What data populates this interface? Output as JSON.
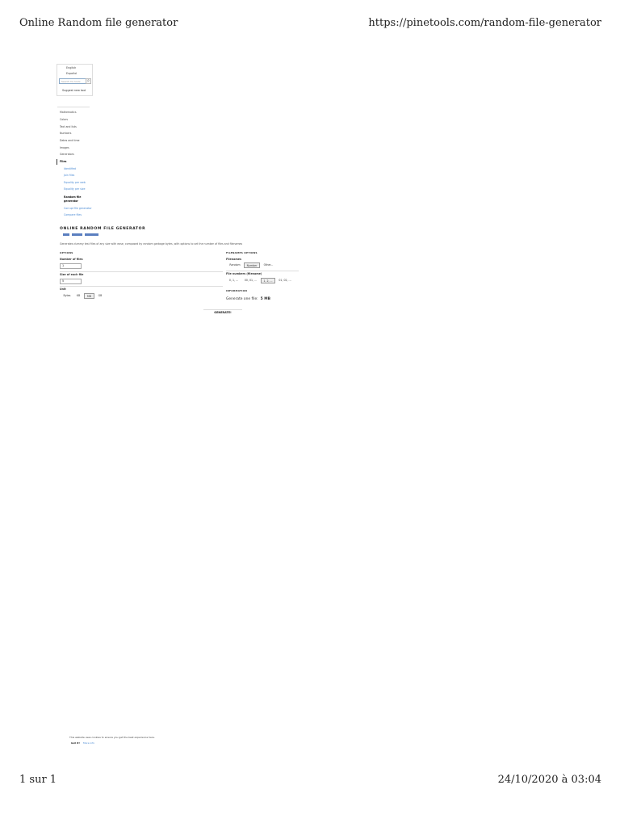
{
  "print_header": {
    "title": "Online Random file generator",
    "url": "https://pinetools.com/random-file-generator"
  },
  "print_footer": {
    "page": "1 sur 1",
    "datetime": "24/10/2020 à 03:04"
  },
  "sidebar": {
    "languages": [
      "English",
      "Español"
    ],
    "search_placeholder": "Search for tools",
    "search_icon": "magnifier-icon",
    "suggest_label": "Suggest new tool",
    "categories": [
      "Mathematics",
      "Colors",
      "Text and lists",
      "Numbers",
      "Dates and time",
      "Images",
      "Generators",
      "Files"
    ],
    "files_subitems": [
      "Identified",
      "Join files",
      "Equality per web",
      "Equality per size",
      "Random file generator",
      "Corrupt file generator",
      "Compare files"
    ],
    "active_subitem": "Random file generator"
  },
  "main": {
    "title": "ONLINE RANDOM FILE GENERATOR",
    "description": "Generates dummy test files of any size with ease, composed by random garbage bytes, with options to set the number of files and filenames",
    "options": {
      "heading": "OPTIONS",
      "number_label": "Number of files",
      "number_value": "1",
      "size_label": "Size of each file",
      "size_value": "5",
      "unit_label": "Unit",
      "units": [
        "Bytes",
        "KB",
        "MB",
        "GB"
      ],
      "selected_unit": "MB"
    },
    "filename_options": {
      "heading": "FILENAMES OPTIONS",
      "filenames_label": "Filenames",
      "filename_modes": [
        "Random",
        "Number",
        "Other..."
      ],
      "selected_mode": "Number",
      "numbers_label": "File numbers (filename)",
      "number_formats": [
        "0, 1, ...",
        "00, 01, ...",
        "1, 2, ...",
        "01, 02, ..."
      ],
      "selected_format": "1, 2, ..."
    },
    "information": {
      "heading": "INFORMATION",
      "text": "Generate one file:",
      "size": "5 MB"
    },
    "generate_label": "GENERATE!"
  },
  "cookie": {
    "text": "This website uses cookies to ensure you get the best experience here.",
    "got_it": "Got it!",
    "more": "More info"
  }
}
